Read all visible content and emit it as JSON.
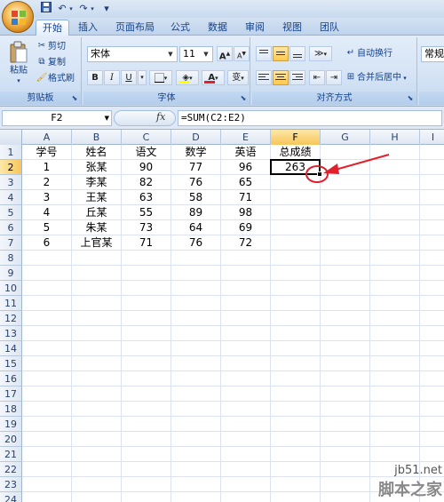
{
  "qat": {
    "undo": "↶",
    "redo": "↷",
    "customize": "▾"
  },
  "tabs": [
    "开始",
    "插入",
    "页面布局",
    "公式",
    "数据",
    "审阅",
    "视图",
    "团队"
  ],
  "ribbon": {
    "clipboard": {
      "paste": "粘贴",
      "cut": "剪切",
      "copy": "复制",
      "format_painter": "格式刷",
      "label": "剪贴板"
    },
    "font": {
      "name": "宋体",
      "size": "11",
      "bold": "B",
      "italic": "I",
      "underline": "U",
      "label": "字体",
      "grow": "A",
      "shrink": "A",
      "color_letter": "A",
      "phonetic": "变"
    },
    "alignment": {
      "wrap": "自动换行",
      "merge": "合并后居中",
      "label": "对齐方式"
    },
    "number": {
      "format": "常规"
    }
  },
  "formula_bar": {
    "name_box": "F2",
    "fx": "fx",
    "formula": "=SUM(C2:E2)"
  },
  "columns": [
    "A",
    "B",
    "C",
    "D",
    "E",
    "F",
    "G",
    "H",
    "I"
  ],
  "active_col": "F",
  "active_row": 2,
  "row_count": 24,
  "table": [
    [
      "学号",
      "姓名",
      "语文",
      "数学",
      "英语",
      "总成绩"
    ],
    [
      "1",
      "张某",
      "90",
      "77",
      "96",
      "263"
    ],
    [
      "2",
      "李某",
      "82",
      "76",
      "65",
      ""
    ],
    [
      "3",
      "王某",
      "63",
      "58",
      "71",
      ""
    ],
    [
      "4",
      "丘某",
      "55",
      "89",
      "98",
      ""
    ],
    [
      "5",
      "朱某",
      "73",
      "64",
      "69",
      ""
    ],
    [
      "6",
      "上官某",
      "71",
      "76",
      "72",
      ""
    ]
  ],
  "watermark": {
    "url": "jb51.net",
    "name": "脚本之家"
  },
  "colors": {
    "annotation": "#e0202a",
    "ribbon": "#d4e3f5"
  }
}
